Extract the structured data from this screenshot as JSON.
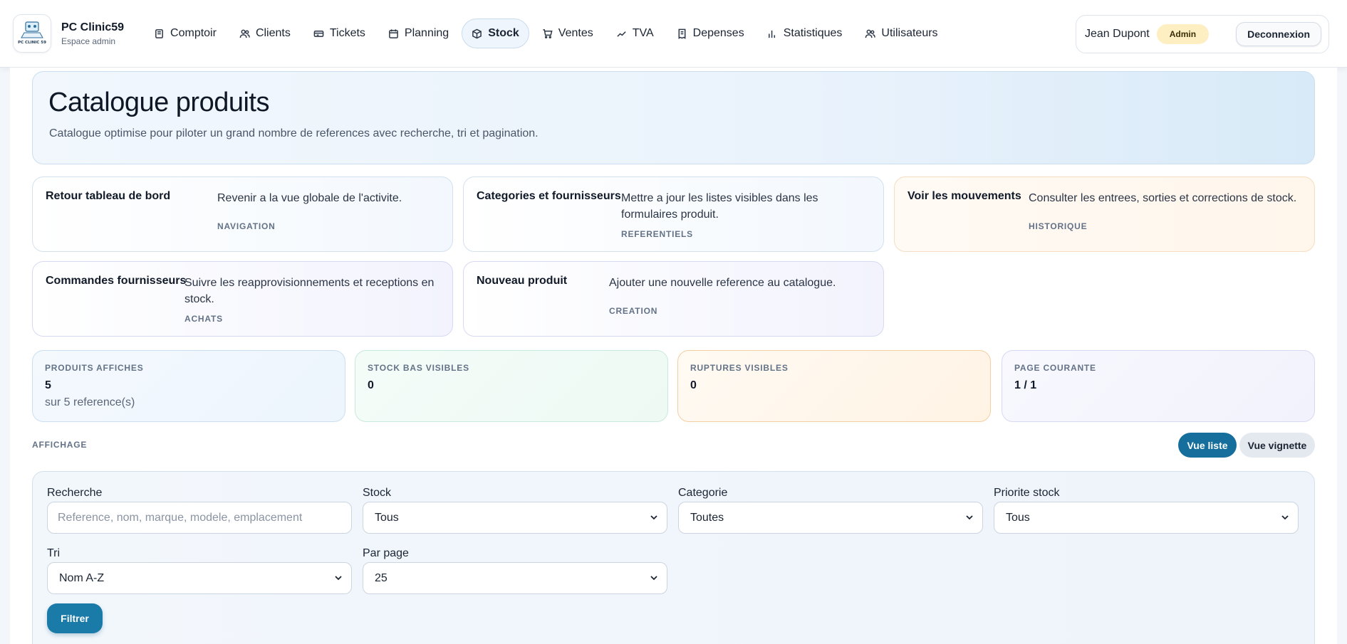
{
  "brand": {
    "title": "PC Clinic59",
    "subtitle": "Espace admin",
    "logo_text": "PC CLINIC 59"
  },
  "nav": [
    {
      "label": "Comptoir",
      "icon": "register-icon"
    },
    {
      "label": "Clients",
      "icon": "users-icon"
    },
    {
      "label": "Tickets",
      "icon": "ticket-icon"
    },
    {
      "label": "Planning",
      "icon": "calendar-icon"
    },
    {
      "label": "Stock",
      "icon": "box-icon",
      "active": true
    },
    {
      "label": "Ventes",
      "icon": "cart-icon"
    },
    {
      "label": "TVA",
      "icon": "trend-icon"
    },
    {
      "label": "Depenses",
      "icon": "receipt-icon"
    },
    {
      "label": "Statistiques",
      "icon": "bar-chart-icon"
    },
    {
      "label": "Utilisateurs",
      "icon": "users-icon"
    }
  ],
  "user": {
    "name": "Jean Dupont",
    "role": "Admin",
    "logout": "Deconnexion"
  },
  "hero": {
    "title": "Catalogue produits",
    "subtitle": "Catalogue optimise pour piloter un grand nombre de references avec recherche, tri et pagination."
  },
  "cards": [
    {
      "title": "Retour tableau de bord",
      "desc": "Revenir a la vue globale de l'activite.",
      "tag": "NAVIGATION"
    },
    {
      "title": "Categories et fournisseurs",
      "desc": "Mettre a jour les listes visibles dans les formulaires produit.",
      "tag": "REFERENTIELS"
    },
    {
      "title": "Voir les mouvements",
      "desc": "Consulter les entrees, sorties et corrections de stock.",
      "tag": "HISTORIQUE"
    },
    {
      "title": "Commandes fournisseurs",
      "desc": "Suivre les reapprovisionnements et receptions en stock.",
      "tag": "ACHATS"
    },
    {
      "title": "Nouveau produit",
      "desc": "Ajouter une nouvelle reference au catalogue.",
      "tag": "CREATION"
    }
  ],
  "stats": [
    {
      "label": "PRODUITS AFFICHES",
      "value": "5",
      "sub": "sur 5 reference(s)"
    },
    {
      "label": "STOCK BAS VISIBLES",
      "value": "0"
    },
    {
      "label": "RUPTURES VISIBLES",
      "value": "0"
    },
    {
      "label": "PAGE COURANTE",
      "value": "1 / 1"
    }
  ],
  "display": {
    "label": "AFFICHAGE",
    "list_view": "Vue liste",
    "thumb_view": "Vue vignette"
  },
  "filters": {
    "search_label": "Recherche",
    "search_placeholder": "Reference, nom, marque, modele, emplacement",
    "stock_label": "Stock",
    "stock_value": "Tous",
    "category_label": "Categorie",
    "category_value": "Toutes",
    "priority_label": "Priorite stock",
    "priority_value": "Tous",
    "sort_label": "Tri",
    "sort_value": "Nom A-Z",
    "perpage_label": "Par page",
    "perpage_value": "25",
    "submit": "Filtrer"
  }
}
